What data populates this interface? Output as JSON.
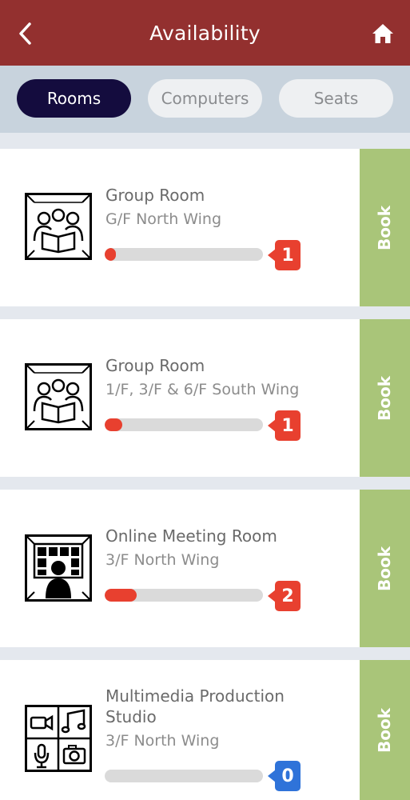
{
  "header": {
    "title": "Availability",
    "back_icon": "chevron-left-icon",
    "home_icon": "home-icon",
    "background": "#93302f"
  },
  "tabs": [
    {
      "label": "Rooms",
      "active": true
    },
    {
      "label": "Computers",
      "active": false
    },
    {
      "label": "Seats",
      "active": false
    }
  ],
  "rooms": [
    {
      "name": "Group Room",
      "location": "G/F North Wing",
      "available": 1,
      "availability_fraction": 0.07,
      "badge_color": "#e8402f",
      "icon": "group-study-icon",
      "book_label": "Book"
    },
    {
      "name": "Group Room",
      "location": "1/F, 3/F & 6/F South Wing",
      "available": 1,
      "availability_fraction": 0.11,
      "badge_color": "#e8402f",
      "icon": "group-study-icon",
      "book_label": "Book"
    },
    {
      "name": "Online Meeting Room",
      "location": "3/F North Wing",
      "available": 2,
      "availability_fraction": 0.2,
      "badge_color": "#e8402f",
      "icon": "video-conference-icon",
      "book_label": "Book"
    },
    {
      "name": "Multimedia Production Studio",
      "location": "3/F North Wing",
      "available": 0,
      "availability_fraction": 0,
      "badge_color": "#2f73d9",
      "icon": "multimedia-studio-icon",
      "book_label": "Book"
    }
  ],
  "colors": {
    "tab_active": "#140c3e",
    "book_button": "#a9c579",
    "bar_fill": "#e8402f"
  }
}
